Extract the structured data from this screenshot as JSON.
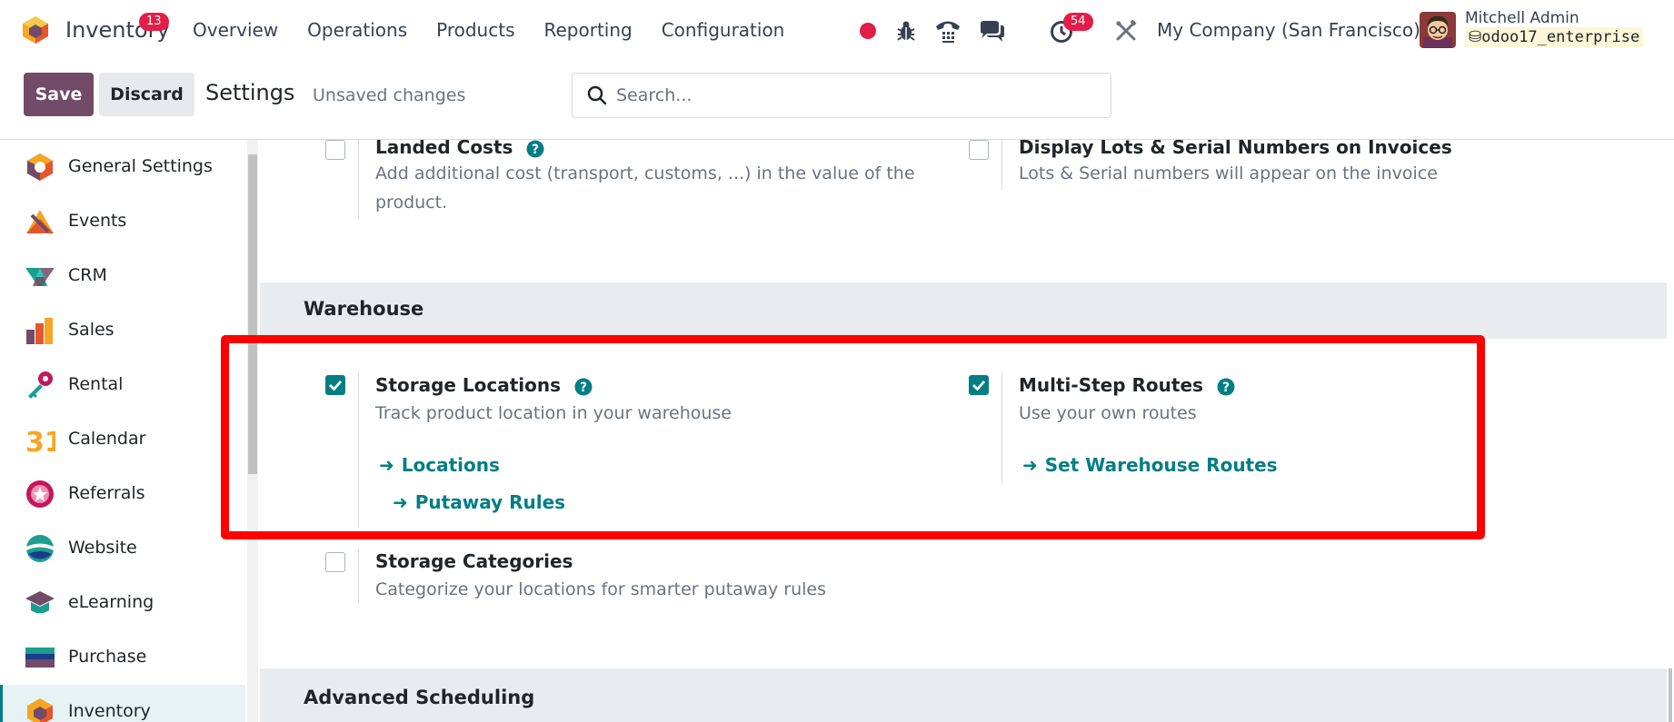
{
  "navbar": {
    "app_name": "Inventory",
    "menu": [
      "Overview",
      "Operations",
      "Products",
      "Reporting",
      "Configuration"
    ],
    "messages_count": "13",
    "activities_count": "54",
    "company": "My Company (San Francisco)",
    "user_name": "Mitchell Admin",
    "database": "odoo17_enterprise"
  },
  "control": {
    "save_label": "Save",
    "discard_label": "Discard",
    "title": "Settings",
    "status": "Unsaved changes",
    "search_placeholder": "Search..."
  },
  "sidebar": {
    "items": [
      {
        "label": "General Settings",
        "icon": "general-settings-icon"
      },
      {
        "label": "Events",
        "icon": "events-icon"
      },
      {
        "label": "CRM",
        "icon": "crm-icon"
      },
      {
        "label": "Sales",
        "icon": "sales-icon"
      },
      {
        "label": "Rental",
        "icon": "rental-icon"
      },
      {
        "label": "Calendar",
        "icon": "calendar-icon",
        "icon_text": "31"
      },
      {
        "label": "Referrals",
        "icon": "referrals-icon"
      },
      {
        "label": "Website",
        "icon": "website-icon"
      },
      {
        "label": "eLearning",
        "icon": "elearning-icon"
      },
      {
        "label": "Purchase",
        "icon": "purchase-icon"
      },
      {
        "label": "Inventory",
        "icon": "inventory-icon",
        "active": true
      }
    ]
  },
  "main": {
    "top_settings": [
      {
        "title": "Landed Costs",
        "desc": "Add additional cost (transport, customs, ...) in the value of the product.",
        "checked": false,
        "help": true
      },
      {
        "title": "Display Lots & Serial Numbers on Invoices",
        "desc": "Lots & Serial numbers will appear on the invoice",
        "checked": false,
        "help": false
      }
    ],
    "warehouse": {
      "header": "Warehouse",
      "storage_locations": {
        "title": "Storage Locations",
        "desc": "Track product location in your warehouse",
        "checked": true,
        "links": [
          "Locations",
          "Putaway Rules"
        ]
      },
      "multi_step_routes": {
        "title": "Multi-Step Routes",
        "desc": "Use your own routes",
        "checked": true,
        "links": [
          "Set Warehouse Routes"
        ]
      },
      "storage_categories": {
        "title": "Storage Categories",
        "desc": "Categorize your locations for smarter putaway rules",
        "checked": false
      }
    },
    "advanced_scheduling": {
      "header": "Advanced Scheduling"
    }
  },
  "colors": {
    "brand": "#714b67",
    "accent": "#017e84",
    "highlight": "#ff0000",
    "badge": "#e11d48"
  }
}
